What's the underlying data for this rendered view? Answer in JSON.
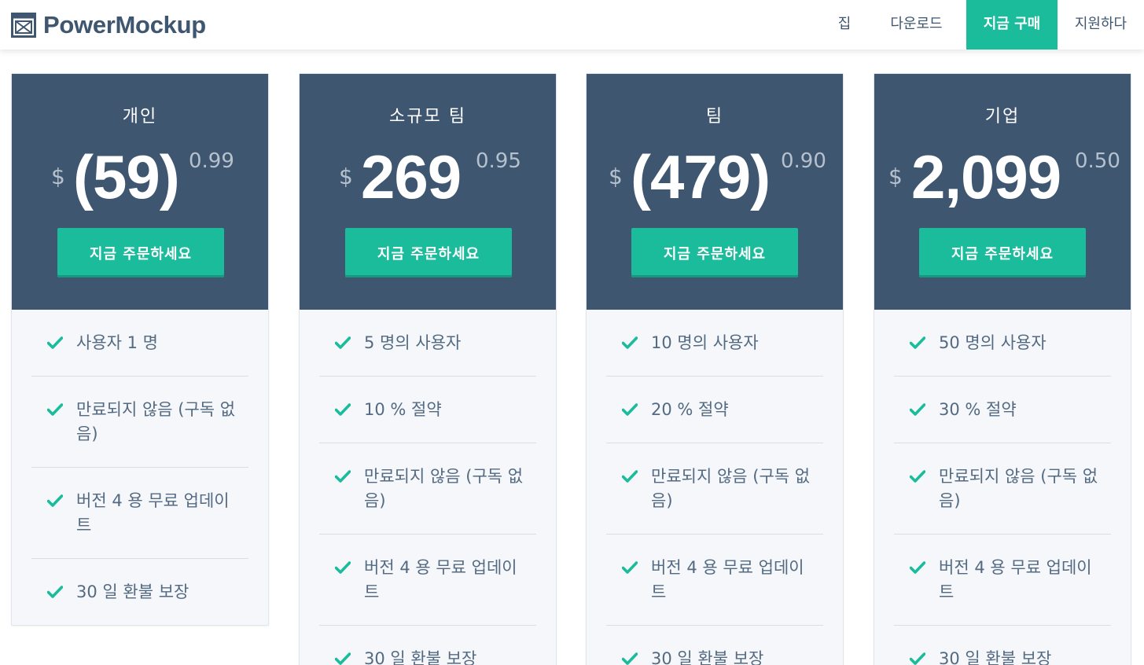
{
  "brand": {
    "name": "PowerMockup",
    "icon": "window-layout-icon"
  },
  "nav": {
    "items": [
      {
        "label": "집",
        "active": false
      },
      {
        "label": "다운로드",
        "active": false
      },
      {
        "label": "지금 구매",
        "active": true
      },
      {
        "label": "지원하다",
        "active": false
      }
    ]
  },
  "colors": {
    "accent": "#1abc9c",
    "card_header": "#3f5671",
    "card_body": "#f5f7fa",
    "text": "#3f5671"
  },
  "plans": [
    {
      "name": "개인",
      "currency": "$",
      "price": "(59)",
      "cents": "0.99",
      "button": "지금 주문하세요",
      "features": [
        "사용자 1 명",
        "만료되지 않음 (구독 없음)",
        "버전 4 용 무료 업데이트",
        "30 일 환불 보장"
      ]
    },
    {
      "name": "소규모 팀",
      "currency": "$",
      "price": "269",
      "cents": "0.95",
      "button": "지금 주문하세요",
      "features": [
        "5 명의 사용자",
        "10 % 절약",
        "만료되지 않음 (구독 없음)",
        "버전 4 용 무료 업데이트",
        "30 일 환불 보장"
      ]
    },
    {
      "name": "팀",
      "currency": "$",
      "price": "(479)",
      "cents": "0.90",
      "button": "지금 주문하세요",
      "features": [
        "10 명의 사용자",
        "20 % 절약",
        "만료되지 않음 (구독 없음)",
        "버전 4 용 무료 업데이트",
        "30 일 환불 보장"
      ]
    },
    {
      "name": "기업",
      "currency": "$",
      "price": "2,099",
      "cents": "0.50",
      "button": "지금 주문하세요",
      "features": [
        "50 명의 사용자",
        "30 % 절약",
        "만료되지 않음 (구독 없음)",
        "버전 4 용 무료 업데이트",
        "30 일 환불 보장"
      ]
    }
  ]
}
